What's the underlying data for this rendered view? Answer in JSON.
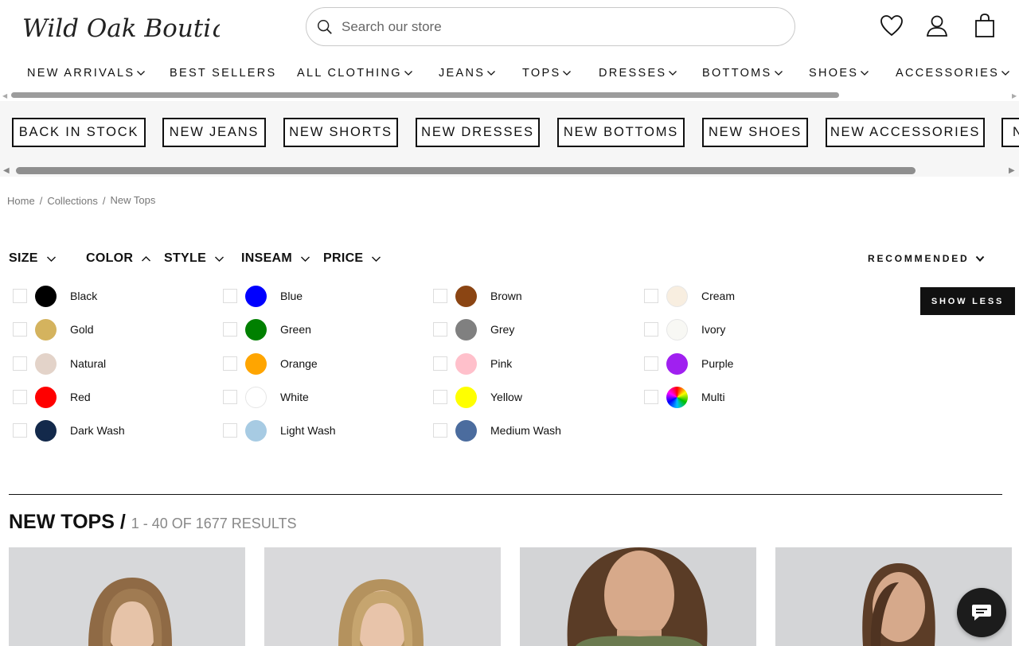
{
  "header": {
    "logo_text": "Wild Oak Boutique",
    "search_placeholder": "Search our store",
    "icons": [
      "heart-icon",
      "account-icon",
      "cart-icon"
    ]
  },
  "nav": {
    "items": [
      {
        "label": "NEW ARRIVALS",
        "dropdown": true
      },
      {
        "label": "BEST SELLERS",
        "dropdown": false
      },
      {
        "label": "ALL CLOTHING",
        "dropdown": true
      },
      {
        "label": "JEANS",
        "dropdown": true
      },
      {
        "label": "TOPS",
        "dropdown": true
      },
      {
        "label": "DRESSES",
        "dropdown": true
      },
      {
        "label": "BOTTOMS",
        "dropdown": true
      },
      {
        "label": "SHOES",
        "dropdown": true
      },
      {
        "label": "ACCESSORIES",
        "dropdown": true
      }
    ]
  },
  "pills": [
    "BACK IN STOCK",
    "NEW JEANS",
    "NEW SHORTS",
    "NEW DRESSES",
    "NEW BOTTOMS",
    "NEW SHOES",
    "NEW ACCESSORIES",
    "N"
  ],
  "breadcrumb": {
    "home": "Home",
    "collections": "Collections",
    "current": "New Tops",
    "sep": "/"
  },
  "filters": {
    "size": "SIZE",
    "color": "COLOR",
    "style": "STYLE",
    "inseam": "INSEAM",
    "price": "PRICE",
    "sort": "RECOMMENDED",
    "show_less": "SHOW LESS"
  },
  "colors": [
    {
      "label": "Black",
      "hex": "#000000"
    },
    {
      "label": "Gold",
      "hex": "#d4b35e"
    },
    {
      "label": "Natural",
      "hex": "#e3d3c9"
    },
    {
      "label": "Red",
      "hex": "#ff0000"
    },
    {
      "label": "Dark Wash",
      "hex": "#13294b"
    },
    {
      "label": "Blue",
      "hex": "#0000ff"
    },
    {
      "label": "Green",
      "hex": "#008000"
    },
    {
      "label": "Orange",
      "hex": "#ffa500"
    },
    {
      "label": "White",
      "hex": "#ffffff"
    },
    {
      "label": "Light Wash",
      "hex": "#a7cbe3"
    },
    {
      "label": "Brown",
      "hex": "#8b4513"
    },
    {
      "label": "Grey",
      "hex": "#808080"
    },
    {
      "label": "Pink",
      "hex": "#ffc0cb"
    },
    {
      "label": "Yellow",
      "hex": "#ffff00"
    },
    {
      "label": "Medium Wash",
      "hex": "#4b6c9e"
    },
    {
      "label": "Cream",
      "hex": "#f8eee0"
    },
    {
      "label": "Ivory",
      "hex": "#f8f8f4"
    },
    {
      "label": "Purple",
      "hex": "#a020f0"
    },
    {
      "label": "Multi",
      "hex": "multi"
    }
  ],
  "results": {
    "title": "NEW TOPS /",
    "count": "1 - 40 OF 1677 RESULTS"
  }
}
